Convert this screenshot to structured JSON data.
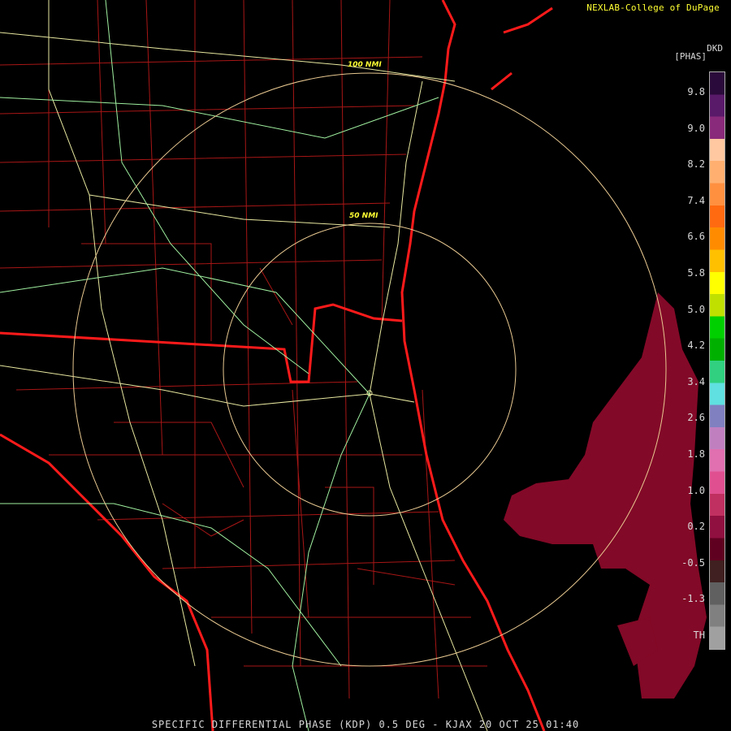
{
  "credit": "NEXLAB-College of DuPage",
  "footer": "SPECIFIC DIFFERENTIAL PHASE (KDP) 0.5 DEG - KJAX 20 OCT 25 01:40",
  "legend": {
    "code": "DKD",
    "unit": "[PHAS]",
    "ticks": [
      "9.8",
      "9.0",
      "8.2",
      "7.4",
      "6.6",
      "5.8",
      "5.0",
      "4.2",
      "3.4",
      "2.6",
      "1.8",
      "1.0",
      "0.2",
      "-0.5",
      "-1.3",
      "TH"
    ],
    "colors": [
      "#2a0a3a",
      "#5a1a6a",
      "#8a2a7a",
      "#ffc8a0",
      "#ffb070",
      "#ff9040",
      "#ff6a10",
      "#ff8c00",
      "#ffc000",
      "#ffff00",
      "#c0e000",
      "#00d000",
      "#00b000",
      "#30d080",
      "#60e0e0",
      "#8080c0",
      "#c080c0",
      "#e070b0",
      "#e05090",
      "#c03060",
      "#901040",
      "#600020",
      "#402020",
      "#606060",
      "#808080",
      "#a0a0a0"
    ]
  },
  "range_rings": [
    {
      "label": "50 NMI",
      "radius_nmi": 50
    },
    {
      "label": "100 NMI",
      "radius_nmi": 100
    }
  ],
  "colors": {
    "state_border": "#ff1a1a",
    "county_border": "#b01818",
    "highway": "#e8e8a0",
    "interstate": "#a0f0a0",
    "ring": "#e8c890",
    "echo": "#8a0a2a"
  }
}
